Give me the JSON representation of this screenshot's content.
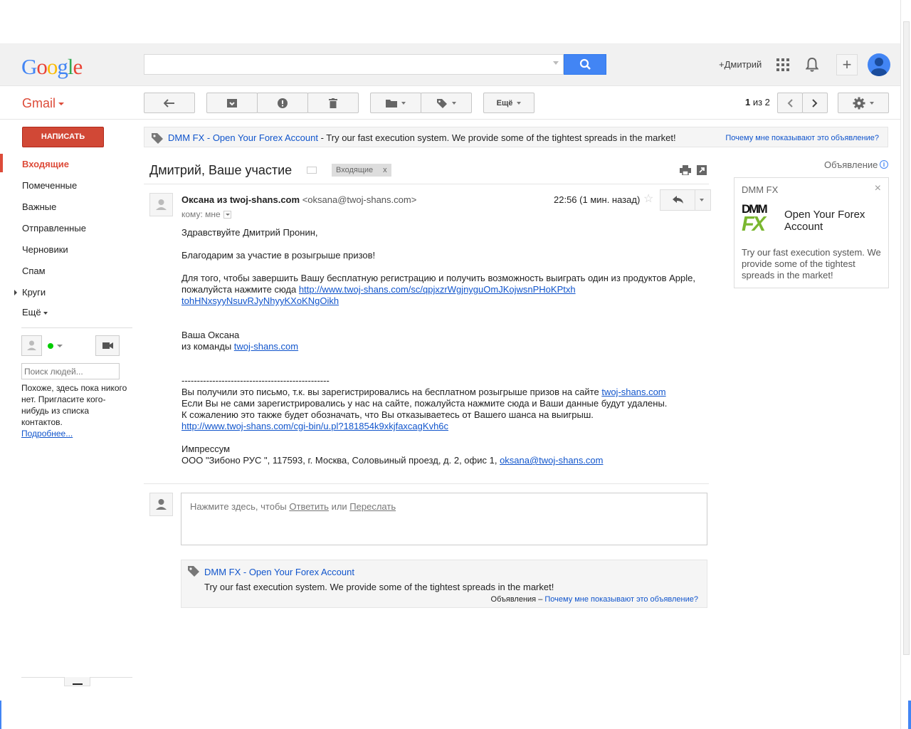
{
  "header": {
    "logo": "Google",
    "search": {
      "value": "",
      "placeholder": ""
    },
    "user_name": "+Дмитрий"
  },
  "gmail_label": "Gmail",
  "toolbar": {
    "more_label": "Ещё",
    "pager_current": "1",
    "pager_rest": " из 2"
  },
  "sidebar": {
    "compose": "НАПИСАТЬ",
    "items": [
      {
        "label": "Входящие",
        "active": true
      },
      {
        "label": "Помеченные"
      },
      {
        "label": "Важные"
      },
      {
        "label": "Отправленные"
      },
      {
        "label": "Черновики"
      },
      {
        "label": "Спам"
      },
      {
        "label": "Круги"
      },
      {
        "label": "Ещё"
      }
    ],
    "people_search_placeholder": "Поиск людей...",
    "chat_empty": "Похоже, здесь пока никого нет. Пригласите кого-нибудь из списка контактов.",
    "chat_more_link": "Подробнее..."
  },
  "top_ad": {
    "title": "DMM FX - Open Your Forex Account",
    "desc": " - Try our fast execution system. We provide some of the tightest spreads in the market!",
    "why": "Почему мне показывают это объявление?"
  },
  "message": {
    "subject": "Дмитрий, Ваше участие",
    "label_chip": "Входящие",
    "label_remove": "x",
    "sender_name": "Оксана из twoj-shans.com",
    "sender_email": "<oksana@twoj-shans.com>",
    "to": "кому: мне",
    "time": "22:56 (1 мин. назад)",
    "greeting": "Здравствуйте Дмитрий Пронин,",
    "thanks": "Благодарим за участие в розыгрыше призов!",
    "para1": "Для того, чтобы завершить Вашу бесплатную регистрацию и получить возможность выиграть один из продуктов Apple, пожалуйста нажмите сюда ",
    "link1": "http://www.twoj-shans.com/sc/qpjxzrWgjnyguOmJKojwsnPHoKPtxh tohHNxsyyNsuvRJyNhyyKXoKNgOikh",
    "sign1": "Ваша Оксана",
    "sign2": "из команды ",
    "sign_link": "twoj-shans.com",
    "separator": "------------------------------------------------",
    "footer1": "Вы получили это письмо, т.к. вы зарегистрировались на бесплатном розыгрыше призов на сайте ",
    "footer1_link": "twoj-shans.com",
    "footer2": "Если Вы не сами зарегистрировались у нас на сайте, пожалуйста нажмите сюда и Ваши данные будут удалены.",
    "footer3": "К сожалению это также  будет обозначать, что Вы отказываетесь от Вашего шанса на выигрыш.",
    "footer_link2": "http://www.twoj-shans.com/cgi-bin/u.pl?181854k9xkjfaxcagKvh6c",
    "impressum": "Импрессум",
    "address": "ООО \"Зибоно РУС \", 117593, г. Москва, Соловьиный проезд, д. 2, офис 1, ",
    "address_email": "oksana@twoj-shans.com"
  },
  "reply": {
    "prefix": "Нажмите здесь, чтобы ",
    "reply_link": "Ответить",
    "or": " или ",
    "forward_link": "Переслать"
  },
  "bottom_ad": {
    "title": "DMM FX - Open Your Forex Account",
    "desc": "Try our fast execution system. We provide some of the tightest spreads in the market!",
    "label": "Объявления – ",
    "why": "Почему мне показывают это объявление?"
  },
  "side_ad": {
    "label": "Объявление",
    "brand": "DMM FX",
    "logo_line1": "DMM",
    "logo_line2": "FX",
    "headline": "Open Your Forex Account",
    "desc": "Try our fast execution system. We provide some of the tightest spreads in the market!"
  },
  "colors": {
    "accent_red": "#dd4b39",
    "search_blue": "#4285f4",
    "link": "#1155cc"
  }
}
